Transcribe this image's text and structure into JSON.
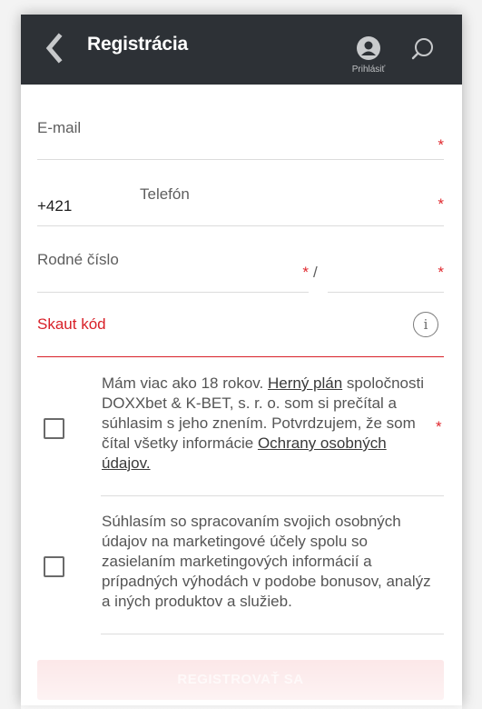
{
  "header": {
    "title": "Registrácia",
    "login_label": "Prihlásiť",
    "back_icon": "chevron-left-icon",
    "user_icon": "user-icon",
    "search_icon": "search-icon"
  },
  "form": {
    "email": {
      "label": "E-mail",
      "required": "*"
    },
    "phone": {
      "prefix": "+421",
      "label": "Telefón",
      "required": "*"
    },
    "birth_number": {
      "label": "Rodné číslo",
      "required": "*",
      "separator": "/",
      "required_suffix": "*"
    },
    "scout_code": {
      "label": "Skaut kód",
      "info": "i"
    }
  },
  "consents": [
    {
      "text_before": "Mám viac ako 18 rokov. ",
      "link1": "Herný plán",
      "text_middle": " spoločnosti DOXXbet & K-BET, s. r. o. som si prečítal a súhlasim s jeho znením. Potvrdzujem, že som čítal všetky informácie ",
      "link2": "Ochrany osobných údajov.",
      "required": "*"
    },
    {
      "text": "Súhlasím so spracovaním svojich osobných údajov na marketingové účely spolu so zasielaním marketingových informácií a prípadných výhodách v podobe bonusov, analýz a iných produktov a služieb."
    }
  ],
  "submit_label": "REGISTROVAŤ SA",
  "colors": {
    "header_bg": "#2d3136",
    "accent_red": "#e0282e",
    "submit_bg": "#fbe3e4"
  }
}
